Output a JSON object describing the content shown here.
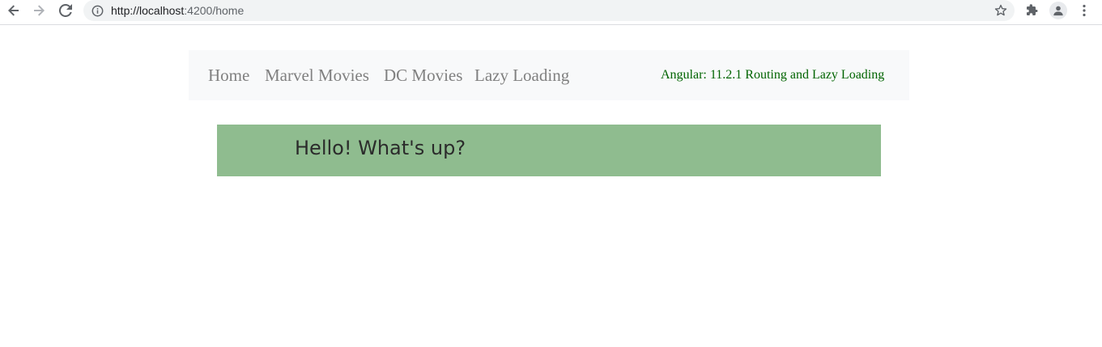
{
  "browser": {
    "url_host": "http://localhost",
    "url_port_path": ":4200/home"
  },
  "navbar": {
    "links": [
      {
        "label": "Home"
      },
      {
        "label": "Marvel Movies"
      },
      {
        "label": "DC Movies"
      },
      {
        "label": "Lazy Loading"
      }
    ],
    "brand": "Angular: 11.2.1 Routing and Lazy Loading"
  },
  "banner": {
    "text": "Hello! What's up?"
  },
  "colors": {
    "navbar_bg": "#f8f9fa",
    "nav_link": "#808080",
    "brand": "#006400",
    "banner_bg": "#8fbc8f"
  }
}
